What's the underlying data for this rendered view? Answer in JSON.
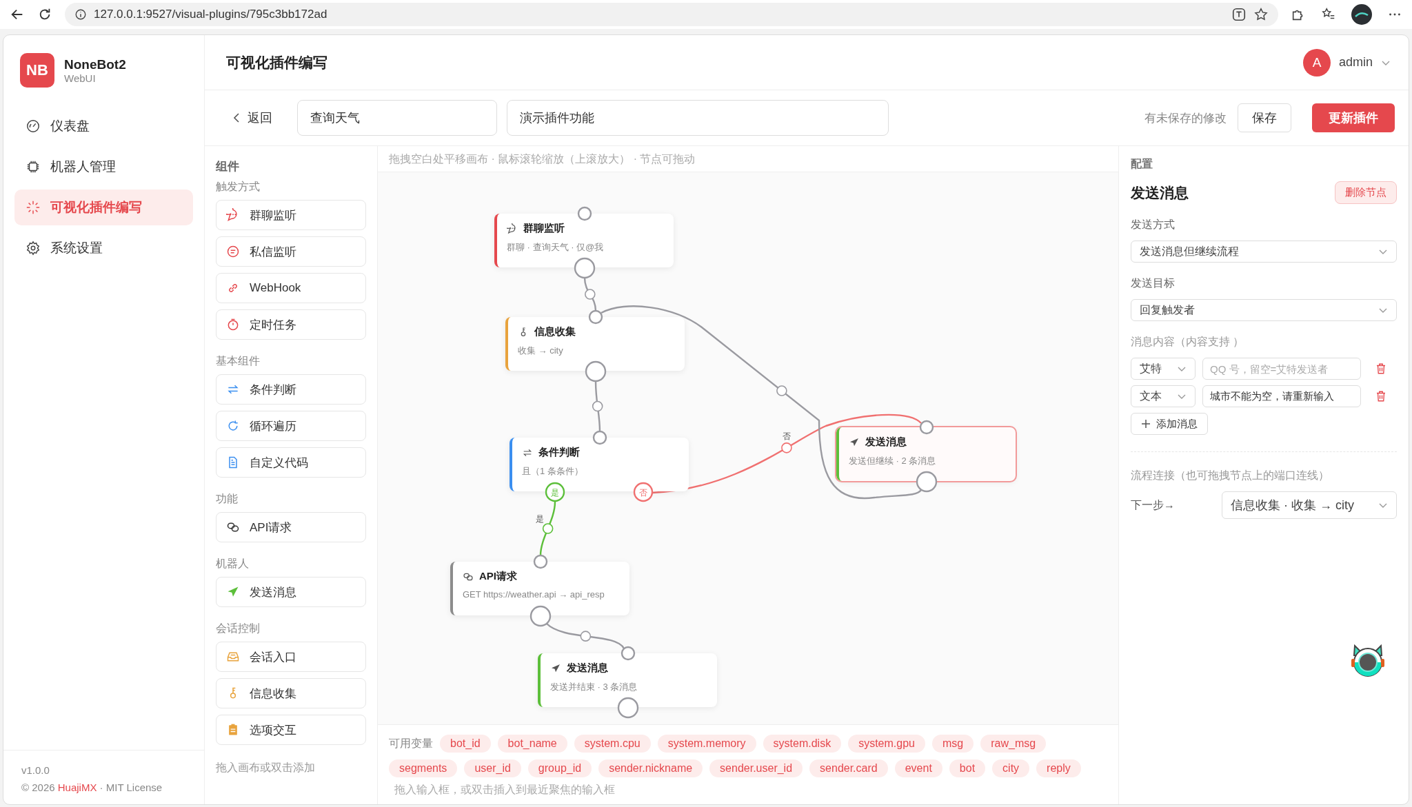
{
  "browser": {
    "url": "127.0.0.1:9527/visual-plugins/795c3bb172ad"
  },
  "sidebar": {
    "logo": "NB",
    "app_name": "NoneBot2",
    "app_subtitle": "WebUI",
    "nav": [
      {
        "label": "仪表盘",
        "selected": false
      },
      {
        "label": "机器人管理",
        "selected": false
      },
      {
        "label": "可视化插件编写",
        "selected": true
      },
      {
        "label": "系统设置",
        "selected": false
      }
    ],
    "version": "v1.0.0",
    "copyright": "© 2026",
    "author": "HuajiMX",
    "license": "· MIT License"
  },
  "header": {
    "title": "可视化插件编写",
    "avatar": "A",
    "user": "admin"
  },
  "toolbar": {
    "back": "返回",
    "plugin_name": "查询天气",
    "plugin_description": "演示插件功能",
    "unsaved_notice": "有未保存的修改",
    "save": "保存",
    "update": "更新插件"
  },
  "palette": {
    "title": "组件",
    "groups": [
      {
        "label": "触发方式",
        "items": [
          {
            "label": "群聊监听"
          },
          {
            "label": "私信监听"
          },
          {
            "label": "WebHook"
          },
          {
            "label": "定时任务"
          }
        ]
      },
      {
        "label": "基本组件",
        "items": [
          {
            "label": "条件判断"
          },
          {
            "label": "循环遍历"
          },
          {
            "label": "自定义代码"
          }
        ]
      },
      {
        "label": "功能",
        "items": [
          {
            "label": "API请求"
          }
        ]
      },
      {
        "label": "机器人",
        "items": [
          {
            "label": "发送消息"
          }
        ]
      },
      {
        "label": "会话控制",
        "items": [
          {
            "label": "会话入口"
          },
          {
            "label": "信息收集"
          },
          {
            "label": "选项交互"
          }
        ]
      }
    ],
    "hint": "拖入画布或双击添加"
  },
  "canvas": {
    "hint": "拖拽空白处平移画布 · 鼠标滚轮缩放（上滚放大） · 节点可拖动",
    "nodes": [
      {
        "kind": "trigger",
        "title": "群聊监听",
        "subtitle": "群聊 · 查询天气 · 仅@我",
        "color": "#e5484d",
        "selected": false
      },
      {
        "kind": "basic",
        "title": "信息收集",
        "subtitle": "收集 → city",
        "color": "#e8a33d",
        "selected": false
      },
      {
        "kind": "condition",
        "title": "条件判断",
        "subtitle": "且（1 条条件）",
        "color": "#3b8ff0",
        "selected": false,
        "yes": "是",
        "no": "否"
      },
      {
        "kind": "basic",
        "title": "发送消息",
        "subtitle": "发送但继续 · 2 条消息",
        "color": "#5cbf3a",
        "selected": true
      },
      {
        "kind": "basic",
        "title": "API请求",
        "subtitle": "GET https://weather.api → api_resp",
        "color": "#8c8c8c",
        "selected": false
      },
      {
        "kind": "basic",
        "title": "发送消息",
        "subtitle": "发送并结束 · 3 条消息",
        "color": "#5cbf3a",
        "selected": false
      }
    ],
    "edges": [
      {
        "kind": "default"
      },
      {
        "kind": "default"
      },
      {
        "kind": "true",
        "label": "是"
      },
      {
        "kind": "false",
        "label": "否"
      },
      {
        "kind": "default"
      },
      {
        "kind": "default"
      }
    ]
  },
  "variables": {
    "label": "可用变量",
    "chips": [
      "bot_id",
      "bot_name",
      "system.cpu",
      "system.memory",
      "system.disk",
      "system.gpu",
      "msg",
      "raw_msg",
      "segments",
      "user_id",
      "group_id",
      "sender.nickname",
      "sender.user_id",
      "sender.card",
      "event",
      "bot",
      "city",
      "reply"
    ],
    "hint": "拖入输入框，或双击插入到最近聚焦的输入框"
  },
  "config": {
    "title": "配置",
    "node_title": "发送消息",
    "delete": "删除节点",
    "send_mode_label": "发送方式",
    "send_mode": "发送消息但继续流程",
    "target_label": "发送目标",
    "target": "回复触发者",
    "content_label": "消息内容（内容支持 ）",
    "messages": [
      {
        "type": "艾特",
        "placeholder": "QQ 号，留空=艾特发送者"
      },
      {
        "type": "文本",
        "value": "城市不能为空，请重新输入"
      }
    ],
    "add_message": "添加消息",
    "flow_label": "流程连接（也可拖拽节点上的端口连线）",
    "next_label": "下一步→",
    "next": "信息收集 · 收集 → city"
  }
}
